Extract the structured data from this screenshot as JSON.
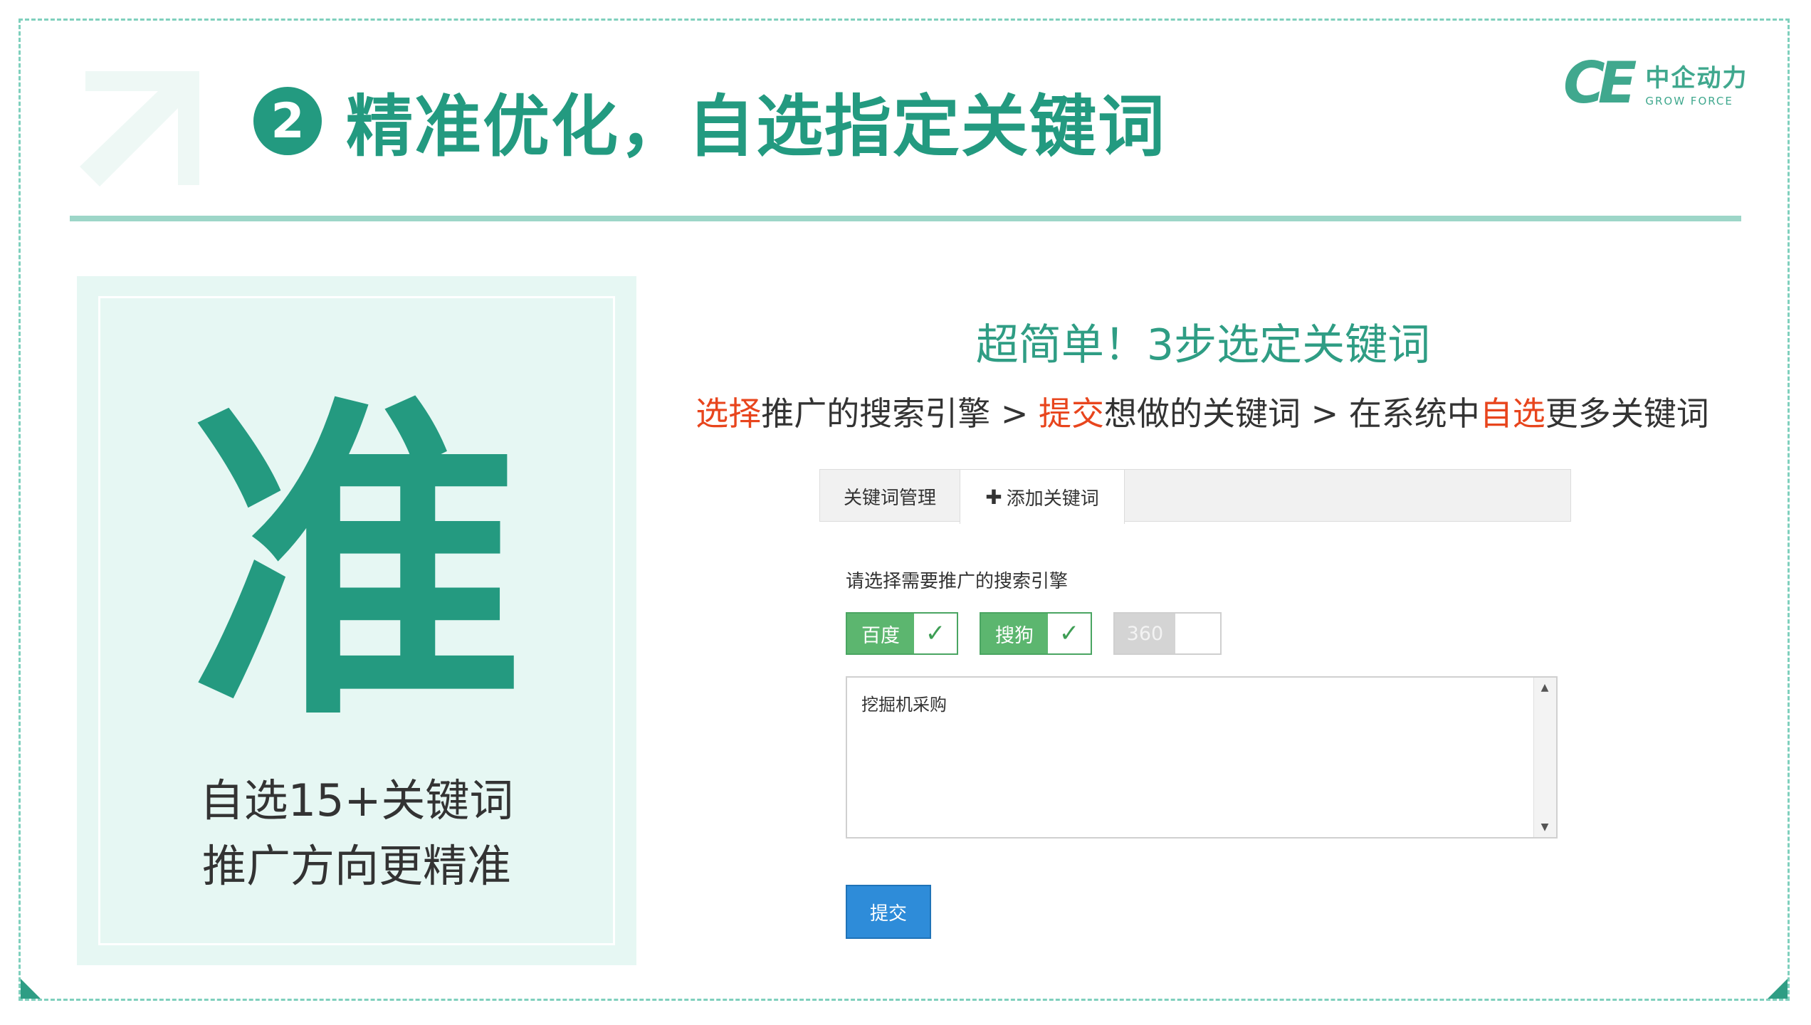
{
  "slide": {
    "title_number": "❷",
    "title": "精准优化，自选指定关键词",
    "colors": {
      "accent": "#239a80",
      "highlight": "#e8451d",
      "panel_bg": "#e6f7f3",
      "button": "#2e8cd9"
    }
  },
  "logo": {
    "mark": "CE",
    "cn": "中企动力",
    "en": "GROW FORCE"
  },
  "left_panel": {
    "big_char": "准",
    "caption_line1": "自选15+关键词",
    "caption_line2": "推广方向更精准"
  },
  "right": {
    "title": "超简单！3步选定关键词",
    "steps": {
      "s1_hl": "选择",
      "s1_rest": "推广的搜索引擎",
      "sep1": " > ",
      "s2_hl": "提交",
      "s2_rest": "想做的关键词",
      "sep2": " > ",
      "s3_pre": "在系统中",
      "s3_hl": "自选",
      "s3_rest": "更多关键词"
    }
  },
  "ui": {
    "tabs": [
      {
        "label": "关键词管理"
      },
      {
        "label": "添加关键词",
        "icon": "plus-icon"
      }
    ],
    "engine_label": "请选择需要推广的搜索引擎",
    "engines": [
      {
        "label": "百度",
        "checked": true,
        "check_glyph": "✓"
      },
      {
        "label": "搜狗",
        "checked": true,
        "check_glyph": "✓"
      },
      {
        "label": "360",
        "checked": false,
        "check_glyph": ""
      }
    ],
    "keywords_value": "挖掘机采购",
    "submit_label": "提交"
  }
}
